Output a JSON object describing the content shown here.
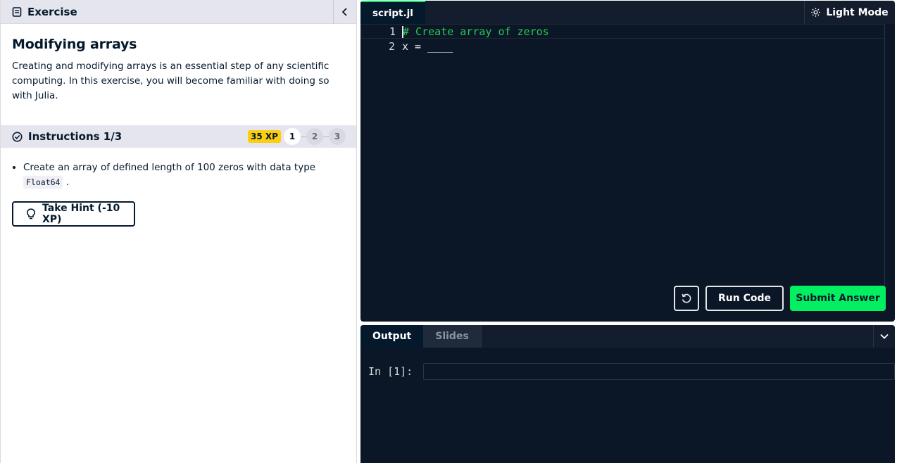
{
  "exercise": {
    "header_title": "Exercise",
    "title": "Modifying arrays",
    "description": "Creating and modifying arrays is an essential step of any scientific computing. In this exercise, you will become familiar with doing so with Julia."
  },
  "instructions": {
    "title": "Instructions 1/3",
    "xp": "35 XP",
    "steps": [
      "1",
      "2",
      "3"
    ],
    "active_step": 1,
    "bullet_text": "Create an array of defined length of 100 zeros with data type ",
    "bullet_code": "Float64",
    "bullet_end": ".",
    "hint_label": "Take Hint (-10 XP)"
  },
  "editor": {
    "file_tab": "script.jl",
    "light_mode_label": "Light Mode",
    "lines": [
      {
        "number": "1",
        "text": "# Create array of zeros"
      },
      {
        "number": "2",
        "text": "x = ____"
      }
    ],
    "run_label": "Run Code",
    "submit_label": "Submit Answer"
  },
  "console": {
    "tabs": [
      "Output",
      "Slides"
    ],
    "active_tab": "Output",
    "prompt": "In [1]:"
  },
  "colors": {
    "accent_green": "#03ef62",
    "xp_yellow": "#fcce0d",
    "editor_bg": "#0b1727",
    "comment_green": "#2bc653"
  }
}
